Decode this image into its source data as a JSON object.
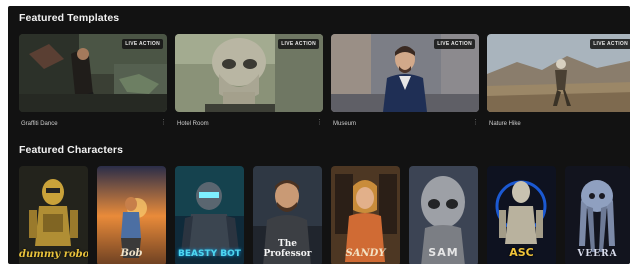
{
  "sections": {
    "templates_title": "Featured Templates",
    "characters_title": "Featured Characters"
  },
  "templates": [
    {
      "name": "Graffiti Dance",
      "badge": "LIVE ACTION",
      "more": "⋮"
    },
    {
      "name": "Hotel Room",
      "badge": "LIVE ACTION",
      "more": "⋮"
    },
    {
      "name": "Museum",
      "badge": "LIVE ACTION",
      "more": "⋮"
    },
    {
      "name": "Nature Hike",
      "badge": "LIVE ACTION",
      "more": "⋮"
    }
  ],
  "characters": [
    {
      "label": "dummy robot"
    },
    {
      "label": "Bob"
    },
    {
      "label": "BEASTY BOT"
    },
    {
      "label": "The Professor"
    },
    {
      "label": "SANDY"
    },
    {
      "label": "SAM"
    },
    {
      "label": "ASC"
    },
    {
      "label": "VEERA"
    }
  ],
  "colors": {
    "background": "#121212",
    "title_text": "#f2f2f2",
    "caption_text": "#cfcfcf"
  }
}
